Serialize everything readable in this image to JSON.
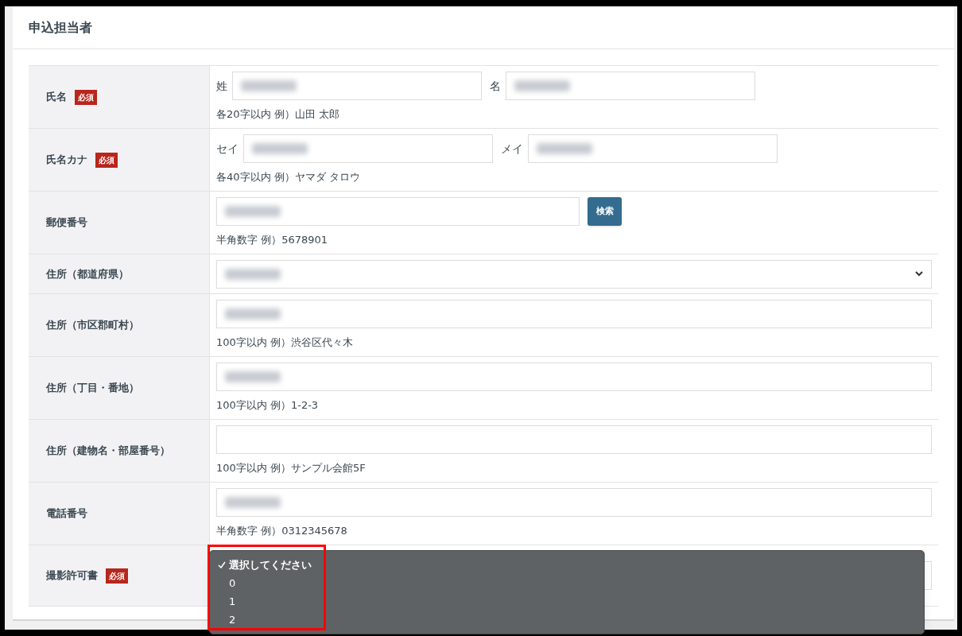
{
  "section_title": "申込担当者",
  "rows": [
    {
      "kind": "name_pair",
      "label": "氏名",
      "required": true,
      "required_badge": "必須",
      "parts": [
        {
          "label": "姓",
          "obscured": true
        },
        {
          "label": "名",
          "obscured": true
        }
      ],
      "hint": "各20字以内 例）山田 太郎"
    },
    {
      "kind": "name_pair",
      "label": "氏名カナ",
      "required": true,
      "required_badge": "必須",
      "parts": [
        {
          "label": "セイ",
          "obscured": true
        },
        {
          "label": "メイ",
          "obscured": true
        }
      ],
      "hint": "各40字以内 例）ヤマダ タロウ"
    },
    {
      "kind": "input_button",
      "label": "郵便番号",
      "required": false,
      "obscured": true,
      "button": "検索",
      "hint": "半角数字 例）5678901"
    },
    {
      "kind": "select",
      "label": "住所（都道府県）",
      "required": false,
      "obscured": true
    },
    {
      "kind": "input",
      "label": "住所（市区郡町村）",
      "required": false,
      "obscured": true,
      "hint": "100字以内 例）渋谷区代々木"
    },
    {
      "kind": "input",
      "label": "住所（丁目・番地）",
      "required": false,
      "obscured": true,
      "hint": "100字以内 例）1-2-3"
    },
    {
      "kind": "input",
      "label": "住所（建物名・部屋番号）",
      "required": false,
      "obscured": false,
      "hint": "100字以内 例）サンプル会館5F"
    },
    {
      "kind": "input",
      "label": "電話番号",
      "required": false,
      "obscured": true,
      "hint": "半角数字 例）0312345678"
    },
    {
      "kind": "select_open",
      "label": "撮影許可書",
      "required": true,
      "required_badge": "必須",
      "options": [
        {
          "label": "選択してください",
          "selected": true
        },
        {
          "label": "0",
          "selected": false
        },
        {
          "label": "1",
          "selected": false
        },
        {
          "label": "2",
          "selected": false
        }
      ],
      "highlighted": true
    }
  ]
}
